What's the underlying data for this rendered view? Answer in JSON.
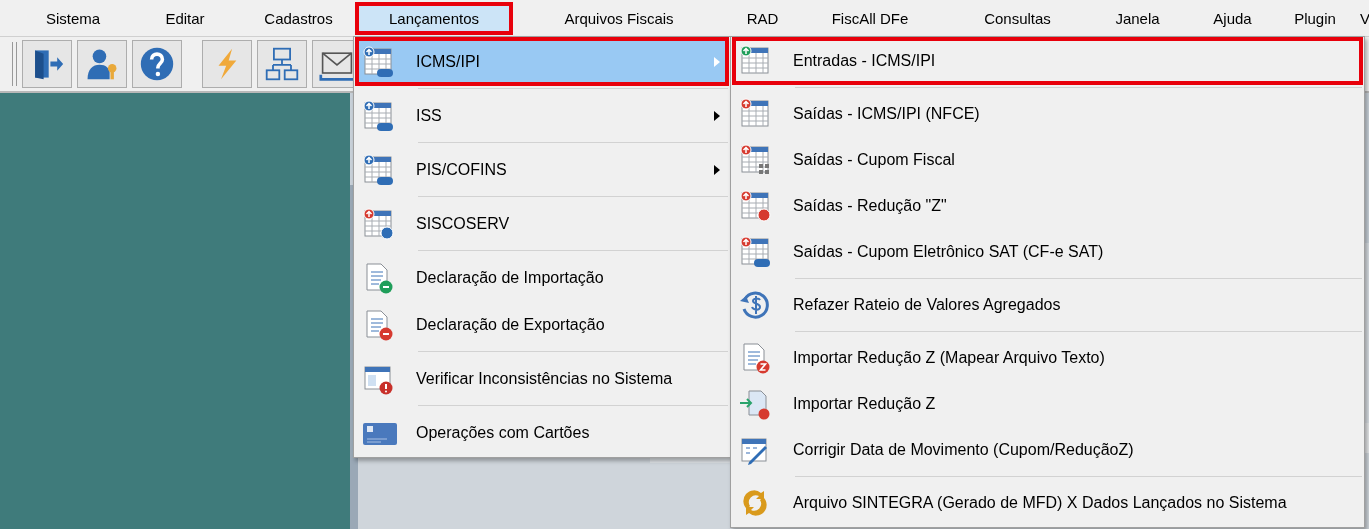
{
  "menu_bar": [
    {
      "label": "Sistema",
      "selected": false,
      "highlighted": false
    },
    {
      "label": "Editar",
      "selected": false,
      "highlighted": false
    },
    {
      "label": "Cadastros",
      "selected": false,
      "highlighted": false
    },
    {
      "label": "Lançamentos",
      "selected": true,
      "highlighted": true
    },
    {
      "label": "Arquivos Fiscais",
      "selected": false,
      "highlighted": false
    },
    {
      "label": "RAD",
      "selected": false,
      "highlighted": false
    },
    {
      "label": "FiscAll DFe",
      "selected": false,
      "highlighted": false
    },
    {
      "label": "Consultas",
      "selected": false,
      "highlighted": false
    },
    {
      "label": "Janela",
      "selected": false,
      "highlighted": false
    },
    {
      "label": "Ajuda",
      "selected": false,
      "highlighted": false
    },
    {
      "label": "Plugin",
      "selected": false,
      "highlighted": false
    },
    {
      "label": "V",
      "selected": false,
      "highlighted": false
    }
  ],
  "lancamentos_menu": [
    {
      "kind": "item",
      "label": "ICMS/IPI",
      "submenu": true,
      "selected": true,
      "highlighted": true
    },
    {
      "kind": "separator"
    },
    {
      "kind": "item",
      "label": "ISS",
      "submenu": true,
      "selected": false,
      "highlighted": false
    },
    {
      "kind": "separator"
    },
    {
      "kind": "item",
      "label": "PIS/COFINS",
      "submenu": true,
      "selected": false,
      "highlighted": false
    },
    {
      "kind": "separator"
    },
    {
      "kind": "item",
      "label": "SISCOSERV",
      "submenu": false,
      "selected": false,
      "highlighted": false
    },
    {
      "kind": "separator"
    },
    {
      "kind": "item",
      "label": "Declaração de Importação",
      "submenu": false,
      "selected": false,
      "highlighted": false
    },
    {
      "kind": "item",
      "label": "Declaração de Exportação",
      "submenu": false,
      "selected": false,
      "highlighted": false
    },
    {
      "kind": "separator"
    },
    {
      "kind": "item",
      "label": "Verificar Inconsistências no Sistema",
      "submenu": false,
      "selected": false,
      "highlighted": false
    },
    {
      "kind": "separator"
    },
    {
      "kind": "item",
      "label": "Operações com Cartões",
      "submenu": false,
      "selected": false,
      "highlighted": false
    }
  ],
  "icms_ipi_menu": [
    {
      "kind": "item",
      "label": "Entradas - ICMS/IPI",
      "selected": false,
      "highlighted": true
    },
    {
      "kind": "separator"
    },
    {
      "kind": "item",
      "label": "Saídas - ICMS/IPI (NFCE)",
      "selected": false,
      "highlighted": false
    },
    {
      "kind": "item",
      "label": "Saídas - Cupom Fiscal",
      "selected": false,
      "highlighted": false
    },
    {
      "kind": "item",
      "label": "Saídas - Redução \"Z\"",
      "selected": false,
      "highlighted": false
    },
    {
      "kind": "item",
      "label": "Saídas - Cupom Eletrônico SAT (CF-e SAT)",
      "selected": false,
      "highlighted": false
    },
    {
      "kind": "separator"
    },
    {
      "kind": "item",
      "label": "Refazer Rateio de Valores Agregados",
      "selected": false,
      "highlighted": false
    },
    {
      "kind": "separator"
    },
    {
      "kind": "item",
      "label": "Importar Redução Z (Mapear Arquivo Texto)",
      "selected": false,
      "highlighted": false
    },
    {
      "kind": "item",
      "label": "Importar Redução Z",
      "selected": false,
      "highlighted": false
    },
    {
      "kind": "item",
      "label": "Corrigir Data de Movimento (Cupom/ReduçãoZ)",
      "selected": false,
      "highlighted": false
    },
    {
      "kind": "separator"
    },
    {
      "kind": "item",
      "label": "Arquivo SINTEGRA (Gerado de MFD) X Dados Lançados no Sistema",
      "selected": false,
      "highlighted": false
    }
  ]
}
